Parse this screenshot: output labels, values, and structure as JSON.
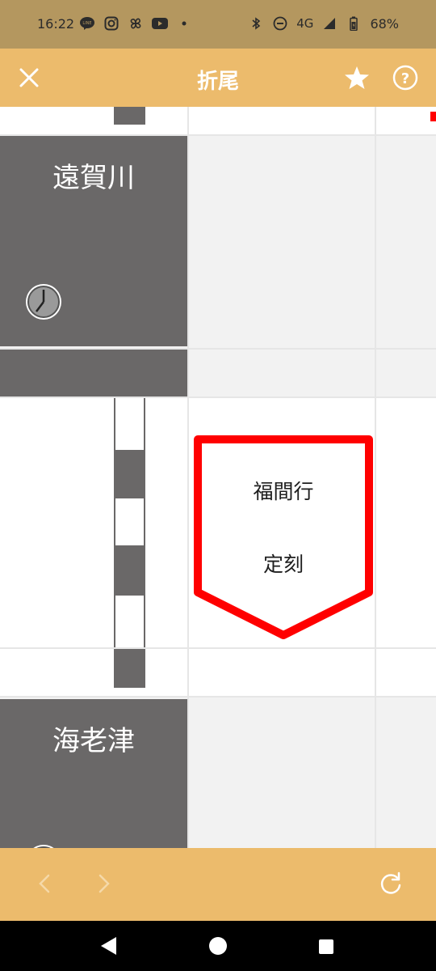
{
  "status_bar": {
    "time": "16:22",
    "network": "4G",
    "battery": "68%",
    "left_icons": [
      "line-icon",
      "instagram-icon",
      "pinwheel-icon",
      "youtube-icon",
      "dot-icon"
    ],
    "right_icons": [
      "bluetooth-icon",
      "dnd-icon",
      "signal-icon",
      "battery-icon"
    ]
  },
  "app_bar": {
    "title": "折尾",
    "left_icon": "close-icon",
    "right_icons": [
      "star-icon",
      "help-icon"
    ]
  },
  "stations": [
    {
      "name": "遠賀川",
      "icon": "clock-icon"
    },
    {
      "name": "海老津",
      "icon": "clock-icon"
    }
  ],
  "train": {
    "destination": "福間行",
    "status": "定刻",
    "border_color": "#ff0000"
  },
  "bottom_bar": {
    "icons": [
      "chevron-left-icon",
      "chevron-right-icon",
      "refresh-icon"
    ]
  },
  "system_nav": {
    "icons": [
      "back-icon",
      "home-icon",
      "recents-icon"
    ]
  },
  "colors": {
    "accent": "#ecbb6c",
    "status_bar": "#b4975f",
    "station_block": "#6a6868",
    "train_border": "#ff0000"
  }
}
